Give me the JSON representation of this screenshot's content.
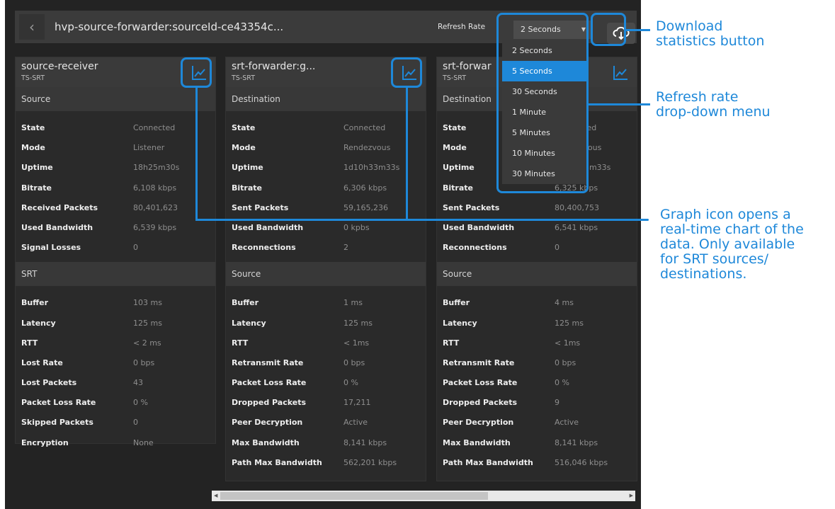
{
  "header": {
    "back_icon": "chevron-left-icon",
    "title": "hvp-source-forwarder:sourceId-ce43354c...",
    "refresh_rate_label": "Refresh Rate",
    "refresh_rate_value": "2 Seconds",
    "download_icon": "cloud-download-icon"
  },
  "dropdown": {
    "items": [
      "2 Seconds",
      "5 Seconds",
      "30 Seconds",
      "1 Minute",
      "5 Minutes",
      "10 Minutes",
      "30 Minutes"
    ],
    "highlighted": "5 Seconds"
  },
  "cards": [
    {
      "title": "source-receiver",
      "subtitle": "TS-SRT",
      "sections": [
        {
          "name": "Source",
          "rows": [
            [
              "State",
              "Connected"
            ],
            [
              "Mode",
              "Listener"
            ],
            [
              "Uptime",
              "18h25m30s"
            ],
            [
              "Bitrate",
              "6,108 kbps"
            ],
            [
              "Received Packets",
              "80,401,623"
            ],
            [
              "Used Bandwidth",
              "6,539 kbps"
            ],
            [
              "Signal Losses",
              "0"
            ]
          ]
        },
        {
          "name": "SRT",
          "rows": [
            [
              "Buffer",
              "103 ms"
            ],
            [
              "Latency",
              "125 ms"
            ],
            [
              "RTT",
              "< 2 ms"
            ],
            [
              "Lost Rate",
              "0 bps"
            ],
            [
              "Lost Packets",
              "43"
            ],
            [
              "Packet Loss Rate",
              "0 %"
            ],
            [
              "Skipped Packets",
              "0"
            ],
            [
              "Encryption",
              "None"
            ]
          ]
        }
      ]
    },
    {
      "title": "srt-forwarder:g...",
      "subtitle": "TS-SRT",
      "sections": [
        {
          "name": "Destination",
          "rows": [
            [
              "State",
              "Connected"
            ],
            [
              "Mode",
              "Rendezvous"
            ],
            [
              "Uptime",
              "1d10h33m33s"
            ],
            [
              "Bitrate",
              "6,306 kbps"
            ],
            [
              "Sent Packets",
              "59,165,236"
            ],
            [
              "Used Bandwidth",
              "0 kpbs"
            ],
            [
              "Reconnections",
              "2"
            ]
          ]
        },
        {
          "name": "Source",
          "rows": [
            [
              "Buffer",
              "1 ms"
            ],
            [
              "Latency",
              "125 ms"
            ],
            [
              "RTT",
              "< 1ms"
            ],
            [
              "Retransmit Rate",
              "0 bps"
            ],
            [
              "Packet Loss Rate",
              "0 %"
            ],
            [
              "Dropped Packets",
              "17,211"
            ],
            [
              "Peer Decryption",
              "Active"
            ],
            [
              "Max Bandwidth",
              "8,141 kbps"
            ],
            [
              "Path Max Bandwidth",
              "562,201 kbps"
            ]
          ]
        }
      ]
    },
    {
      "title": "srt-forwar",
      "subtitle": "TS-SRT",
      "sections": [
        {
          "name": "Destination",
          "rows": [
            [
              "State",
              "Connected"
            ],
            [
              "Mode",
              "Rendezvous"
            ],
            [
              "Uptime",
              "1d10h33m33s"
            ],
            [
              "Bitrate",
              "6,325 kbps"
            ],
            [
              "Sent Packets",
              "80,400,753"
            ],
            [
              "Used Bandwidth",
              "6,541 kbps"
            ],
            [
              "Reconnections",
              "0"
            ]
          ]
        },
        {
          "name": "Source",
          "rows": [
            [
              "Buffer",
              "4 ms"
            ],
            [
              "Latency",
              "125 ms"
            ],
            [
              "RTT",
              "< 1ms"
            ],
            [
              "Retransmit Rate",
              "0 bps"
            ],
            [
              "Packet Loss Rate",
              "0 %"
            ],
            [
              "Dropped Packets",
              "9"
            ],
            [
              "Peer Decryption",
              "Active"
            ],
            [
              "Max Bandwidth",
              "8,141 kbps"
            ],
            [
              "Path Max Bandwidth",
              "516,046 kbps"
            ]
          ]
        }
      ]
    }
  ],
  "callouts": {
    "download_line1": "Download",
    "download_line2": "statistics button",
    "refresh_line1": "Refresh rate",
    "refresh_line2": "drop-down menu",
    "graph_line1": "Graph icon opens a",
    "graph_line2": "real-time chart of the",
    "graph_line3": "data. Only available",
    "graph_line4": "for SRT sources/",
    "graph_line5": "destinations."
  },
  "colors": {
    "accent": "#1e88d9",
    "panel": "#232323",
    "card": "#2a2a2a"
  }
}
